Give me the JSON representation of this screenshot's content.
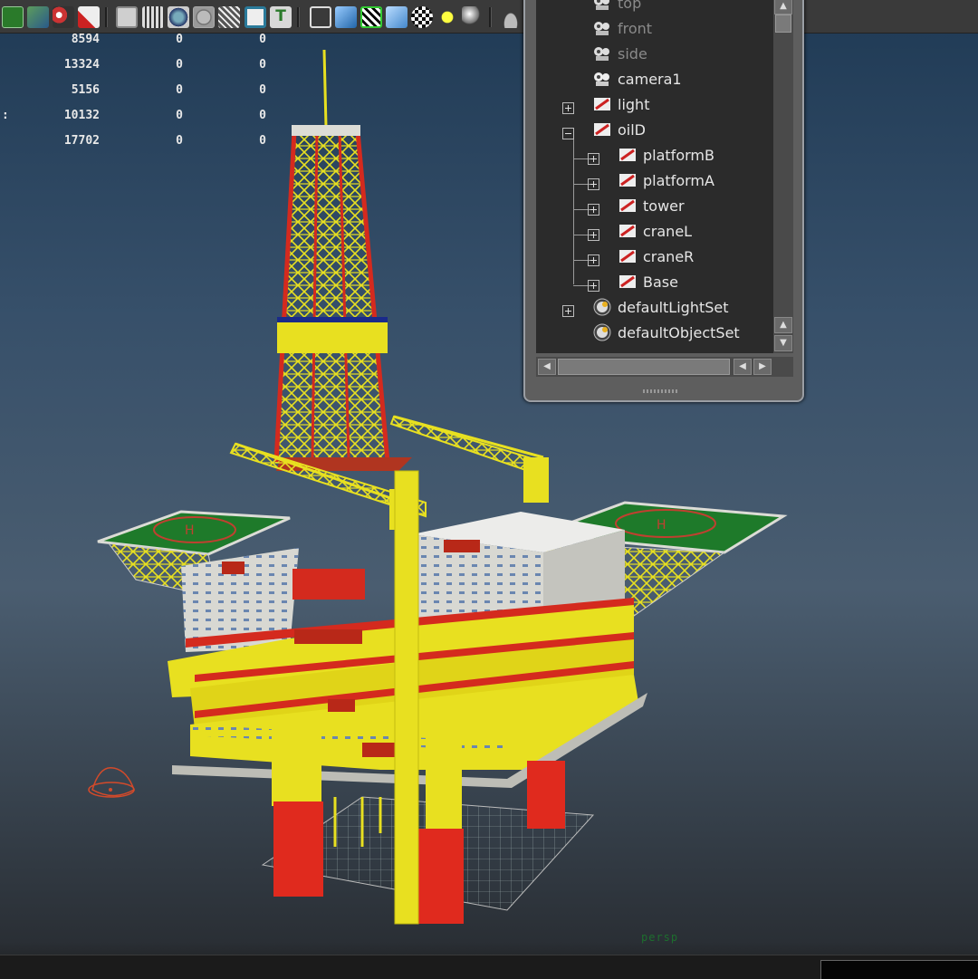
{
  "toolbar": {
    "icons": [
      "render-view-icon",
      "hypershade-icon",
      "ipr-render-icon",
      "render-settings-icon",
      "wireframe-shaded-icon",
      "film-gate-icon",
      "smooth-shade-icon",
      "flat-shade-icon",
      "xray-icon",
      "texture-icon",
      "text-icon",
      "cube-wire-icon",
      "cube-shaded-icon",
      "isolate-select-icon",
      "cube-textured-icon",
      "checker-icon",
      "default-light-icon",
      "sphere-icon",
      "camera-icon"
    ]
  },
  "stats": {
    "rows": [
      {
        "label": "",
        "a": "8594",
        "b": "0",
        "c": "0"
      },
      {
        "label": "",
        "a": "13324",
        "b": "0",
        "c": "0"
      },
      {
        "label": "",
        "a": "5156",
        "b": "0",
        "c": "0"
      },
      {
        "label": ":",
        "a": "10132",
        "b": "0",
        "c": "0"
      },
      {
        "label": "",
        "a": "17702",
        "b": "0",
        "c": "0"
      }
    ]
  },
  "outliner": {
    "items": [
      {
        "label": "top",
        "icon": "camera-icon",
        "dim": true
      },
      {
        "label": "front",
        "icon": "camera-icon",
        "dim": true
      },
      {
        "label": "side",
        "icon": "camera-icon",
        "dim": true
      },
      {
        "label": "camera1",
        "icon": "camera-icon",
        "dim": false
      },
      {
        "label": "light",
        "icon": "transform-icon",
        "dim": false
      },
      {
        "label": "oilD",
        "icon": "transform-icon",
        "dim": false
      },
      {
        "label": "platformB",
        "icon": "transform-icon",
        "dim": false
      },
      {
        "label": "platformA",
        "icon": "transform-icon",
        "dim": false
      },
      {
        "label": "tower",
        "icon": "transform-icon",
        "dim": false
      },
      {
        "label": "craneL",
        "icon": "transform-icon",
        "dim": false
      },
      {
        "label": "craneR",
        "icon": "transform-icon",
        "dim": false
      },
      {
        "label": "Base",
        "icon": "transform-icon",
        "dim": false
      },
      {
        "label": "defaultLightSet",
        "icon": "set-icon",
        "dim": false
      },
      {
        "label": "defaultObjectSet",
        "icon": "set-icon",
        "dim": false
      }
    ]
  },
  "viewport": {
    "camera_label": "persp"
  },
  "colors": {
    "structure_yellow": "#e8e020",
    "leg_red": "#d42a1e",
    "helipad_green": "#1e7a2a",
    "building_white": "#dcdcd6"
  }
}
